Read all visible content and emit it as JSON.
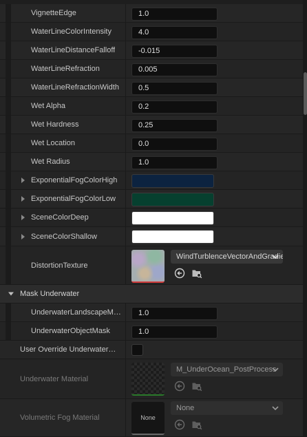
{
  "properties": [
    {
      "label": "VignetteEdge",
      "value": "1.0"
    },
    {
      "label": "WaterLineColorIntensity",
      "value": "4.0"
    },
    {
      "label": "WaterLineDistanceFalloff",
      "value": "-0.015"
    },
    {
      "label": "WaterLineRefraction",
      "value": "0.005"
    },
    {
      "label": "WaterLineRefractionWidth",
      "value": "0.5"
    },
    {
      "label": "Wet Alpha",
      "value": "0.2"
    },
    {
      "label": "Wet Hardness",
      "value": "0.25"
    },
    {
      "label": "Wet Location",
      "value": "0.0"
    },
    {
      "label": "Wet Radius",
      "value": "1.0"
    }
  ],
  "colors": [
    {
      "label": "ExponentialFogColorHigh",
      "color": "#0c2340"
    },
    {
      "label": "ExponentialFogColorLow",
      "color": "#06402f"
    },
    {
      "label": "SceneColorDeep",
      "color": "#ffffff"
    },
    {
      "label": "SceneColorShallow",
      "color": "#ffffff"
    }
  ],
  "distortion": {
    "label": "DistortionTexture",
    "asset": "WindTurblenceVectorAndGradient"
  },
  "mask_section": {
    "title": "Mask Underwater"
  },
  "mask_properties": [
    {
      "label": "UnderwaterLandscapeMask",
      "value": "1.0"
    },
    {
      "label": "UnderwaterObjectMask",
      "value": "1.0"
    }
  ],
  "override": {
    "label": "User Override Underwater Material"
  },
  "underwater_material": {
    "label": "Underwater Material",
    "asset": "M_UnderOcean_PostProcess"
  },
  "volumetric_fog": {
    "label": "Volumetric Fog Material",
    "asset": "None",
    "thumb_text": "None"
  },
  "icons": {
    "use": "arrow-left-circle-icon",
    "browse": "folder-search-icon",
    "dropdown": "chevron-down-icon",
    "expand": "triangle-right-icon",
    "collapse": "triangle-down-icon"
  }
}
